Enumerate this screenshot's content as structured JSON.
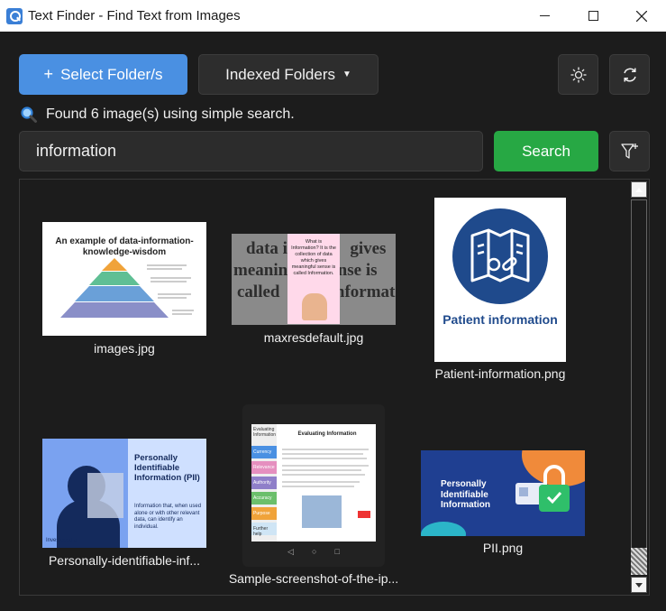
{
  "window": {
    "title": "Text Finder - Find Text from Images",
    "icon": "magnifier-app-icon"
  },
  "toolbar": {
    "select_folder_label": "Select Folder/s",
    "indexed_folders_label": "Indexed Folders",
    "theme_icon": "sun-icon",
    "refresh_icon": "refresh-icon",
    "accent_color": "#4a90e2"
  },
  "status": {
    "text": "Found 6 image(s) using simple search."
  },
  "search": {
    "query": "information",
    "button_label": "Search",
    "button_color": "#27a844",
    "filter_icon": "filter-add-icon"
  },
  "results": [
    {
      "filename": "images.jpg",
      "thumb_title": "An example of data-information-knowledge-wisdom"
    },
    {
      "filename": "maxresdefault.jpg",
      "thumb_big_text": [
        "data is",
        "gives",
        "meaningful",
        "sense is",
        "called",
        "Information."
      ],
      "thumb_card_text": "What is Information? It is the collection of data which gives meaningful sense is called Information."
    },
    {
      "filename": "Patient-information.png",
      "thumb_title": "Patient information"
    },
    {
      "filename": "Personally-identifiable-inf...",
      "thumb_title": "Personally Identifiable Information (PII)",
      "thumb_body": "Information that, when used alone or with other relevant data, can identify an individual.",
      "thumb_brand": "Investopedia"
    },
    {
      "filename": "Sample-screenshot-of-the-ip...",
      "thumb_title": "Evaluating Information",
      "thumb_menu": [
        "Evaluating Information",
        "Currency",
        "Relevance",
        "Authority",
        "Accuracy",
        "Purpose",
        "Further help"
      ]
    },
    {
      "filename": "PII.png",
      "thumb_title": "Personally Identifiable Information"
    }
  ]
}
